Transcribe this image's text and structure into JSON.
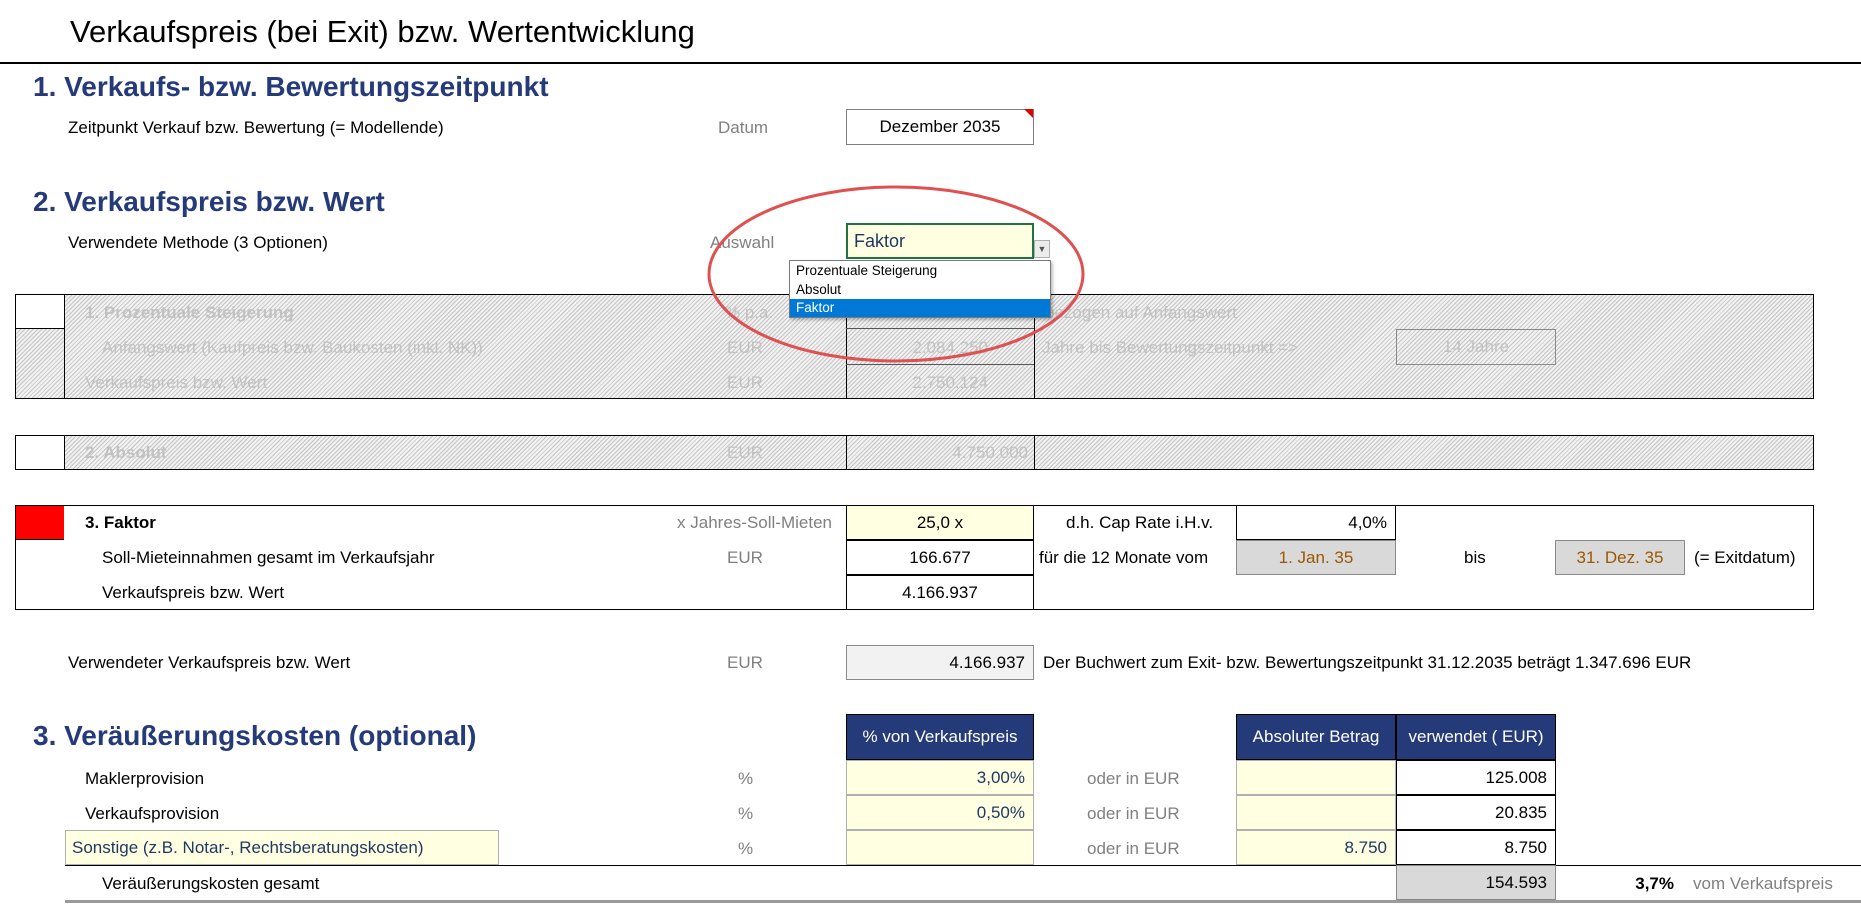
{
  "title": "Verkaufspreis (bei Exit) bzw. Wertentwicklung",
  "section1": {
    "heading": "1. Verkaufs- bzw. Bewertungszeitpunkt",
    "label": "Zeitpunkt Verkauf bzw. Bewertung (= Modellende)",
    "unit": "Datum",
    "value": "Dezember 2035"
  },
  "section2": {
    "heading": "2. Verkaufspreis bzw. Wert",
    "method_label": "Verwendete Methode  (3 Optionen)",
    "method_unit": "Auswahl",
    "method_value": "Faktor",
    "dropdown_options": [
      "Prozentuale Steigerung",
      "Absolut",
      "Faktor"
    ],
    "option1": {
      "title": "1. Prozentuale Steigerung",
      "unit_row1": "% p.a.",
      "note_row1": "bezogen auf Anfangswert",
      "label_row2": "Anfangswert (Kaufpreis bzw. Baukosten (inkl. NK))",
      "unit_row2": "EUR",
      "value_row2": "2.084.250",
      "note_row2": "Jahre bis Bewertungszeitpunkt =>",
      "years": "14 Jahre",
      "label_row3": "Verkaufspreis bzw. Wert",
      "unit_row3": "EUR",
      "value_row3": "2.750.124"
    },
    "option2": {
      "title": "2. Absolut",
      "unit": "EUR",
      "value": "4.750.000"
    },
    "option3": {
      "title": "3. Faktor",
      "factor_unit": "x Jahres-Soll-Mieten",
      "factor_value": "25,0 x",
      "cap_label": "d.h. Cap Rate i.H.v.",
      "cap_value": "4,0%",
      "rent_label": "Soll-Mieteinnahmen gesamt im Verkaufsjahr",
      "rent_unit": "EUR",
      "rent_value": "166.677",
      "period_label": "für die 12 Monate vom",
      "period_from": "1. Jan. 35",
      "period_to_label": "bis",
      "period_to": "31. Dez. 35",
      "period_note": "(= Exitdatum)",
      "price_label": "Verkaufspreis bzw. Wert",
      "price_value": "4.166.937"
    },
    "used": {
      "label": "Verwendeter Verkaufspreis bzw. Wert",
      "unit": "EUR",
      "value": "4.166.937",
      "note": "Der Buchwert zum Exit- bzw. Bewertungszeitpunkt 31.12.2035 beträgt 1.347.696 EUR"
    }
  },
  "section3": {
    "heading": "3. Veräußerungskosten (optional)",
    "col_percent": "% von Verkaufspreis",
    "col_absolute": "Absoluter Betrag",
    "col_used": "verwendet ( EUR)",
    "rows": [
      {
        "label": "Maklerprovision",
        "unit": "%",
        "percent": "3,00%",
        "or": "oder in EUR",
        "absolute": "",
        "used": "125.008"
      },
      {
        "label": "Verkaufsprovision",
        "unit": "%",
        "percent": "0,50%",
        "or": "oder in EUR",
        "absolute": "",
        "used": "20.835"
      },
      {
        "label": "Sonstige (z.B. Notar-, Rechtsberatungskosten)",
        "unit": "%",
        "percent": "",
        "or": "oder in EUR",
        "absolute": "8.750",
        "used": "8.750"
      }
    ],
    "total_label": "Veräußerungskosten gesamt",
    "total_value": "154.593",
    "total_percent": "3,7%",
    "total_suffix": "vom Verkaufspreis"
  },
  "colors": {
    "heading": "#253a78",
    "input_fill": "#ffffe1",
    "header_fill": "#253a78",
    "highlight": "#ff0000",
    "annotation": "#e05050",
    "selection": "#0078d7"
  }
}
